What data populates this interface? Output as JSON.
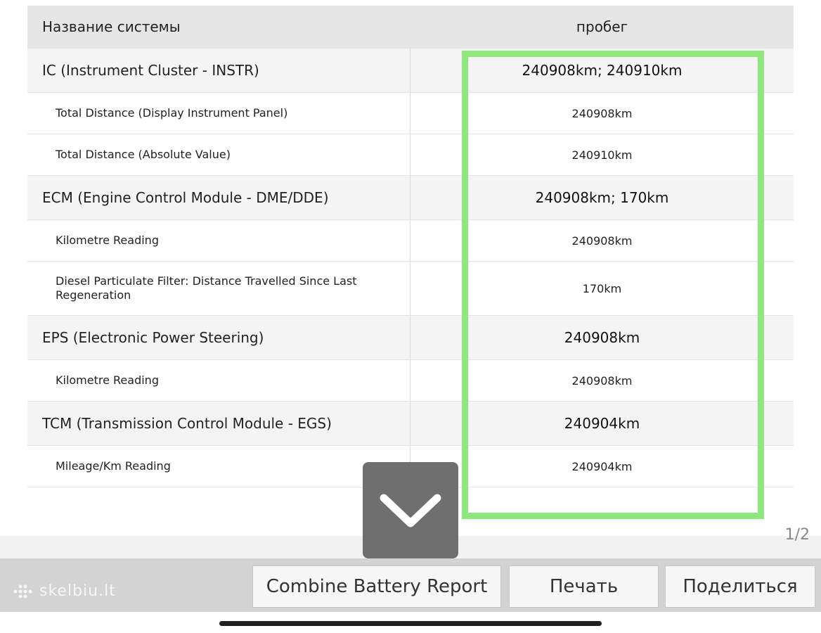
{
  "table": {
    "header": {
      "system": "Название системы",
      "mileage": "пробег"
    },
    "rows": [
      {
        "kind": "system",
        "name": "IC (Instrument Cluster - INSTR)",
        "value": "240908km; 240910km"
      },
      {
        "kind": "sub",
        "name": "Total Distance (Display Instrument Panel)",
        "value": "240908km"
      },
      {
        "kind": "sub",
        "name": "Total Distance (Absolute Value)",
        "value": "240910km"
      },
      {
        "kind": "system",
        "name": "ECM (Engine Control Module - DME/DDE)",
        "value": "240908km; 170km"
      },
      {
        "kind": "sub",
        "name": "Kilometre Reading",
        "value": "240908km"
      },
      {
        "kind": "sub",
        "name": "Diesel Particulate Filter: Distance Travelled Since Last Regeneration",
        "value": "170km"
      },
      {
        "kind": "system",
        "name": "EPS (Electronic Power Steering)",
        "value": "240908km"
      },
      {
        "kind": "sub",
        "name": "Kilometre Reading",
        "value": "240908km"
      },
      {
        "kind": "system",
        "name": "TCM (Transmission Control Module - EGS)",
        "value": "240904km"
      },
      {
        "kind": "sub",
        "name": "Mileage/Km Reading",
        "value": "240904km"
      }
    ]
  },
  "pager": {
    "indicator": "1/2"
  },
  "toolbar": {
    "combine_label": "Combine Battery Report",
    "print_label": "Печать",
    "share_label": "Поделиться"
  },
  "watermark": {
    "text": "skelbiu.lt"
  },
  "colors": {
    "highlight": "#8ee87e",
    "header_bg": "#e6e6e6",
    "system_row_bg": "#f4f4f4",
    "toolbar_bg": "#d3d3d3",
    "scroll_button_bg": "#6f6f6f"
  },
  "icons": {
    "scroll_down": "chevron-down-icon",
    "watermark_logo": "dots-logo-icon"
  }
}
